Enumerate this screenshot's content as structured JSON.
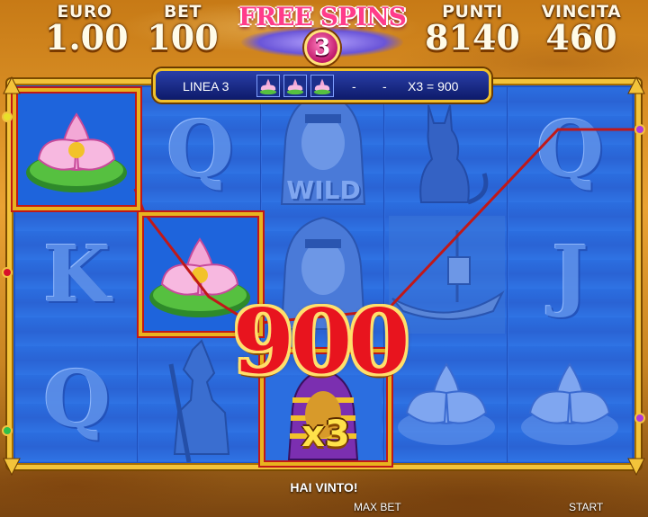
{
  "header": {
    "euro": {
      "label": "EURO",
      "value": "1.00"
    },
    "bet": {
      "label": "BET",
      "value": "100"
    },
    "punti": {
      "label": "PUNTI",
      "value": "8140"
    },
    "vincita": {
      "label": "VINCITA",
      "value": "460"
    }
  },
  "free_spins": {
    "title": "FREE SPINS",
    "count": "3"
  },
  "info_bar": {
    "line_label": "LINEA 3",
    "dash1": "-",
    "dash2": "-",
    "multiplier_text": "X3 = 900"
  },
  "reels": [
    [
      "lotus",
      "K-letter",
      "Q-letter"
    ],
    [
      "Q-letter",
      "lotus",
      "anubis"
    ],
    [
      "pharaoh-wild",
      "pharaoh",
      "pharaoh-x3"
    ],
    [
      "cat",
      "boat",
      "lotus-faded"
    ],
    [
      "Q-letter",
      "J-letter",
      "lotus-faded"
    ]
  ],
  "symbol_letters": {
    "q": "Q",
    "k": "K",
    "j": "J"
  },
  "wild_label": "WILD",
  "win": {
    "amount": "900",
    "multiplier": "x3"
  },
  "footer": {
    "message": "HAI VINTO!",
    "max_bet": "MAX BET",
    "start": "START"
  },
  "colors": {
    "frame": "#f3c33a",
    "win_line": "#c01818",
    "reel_blue": "#2b6ee0",
    "win_number": "#e8141e"
  }
}
